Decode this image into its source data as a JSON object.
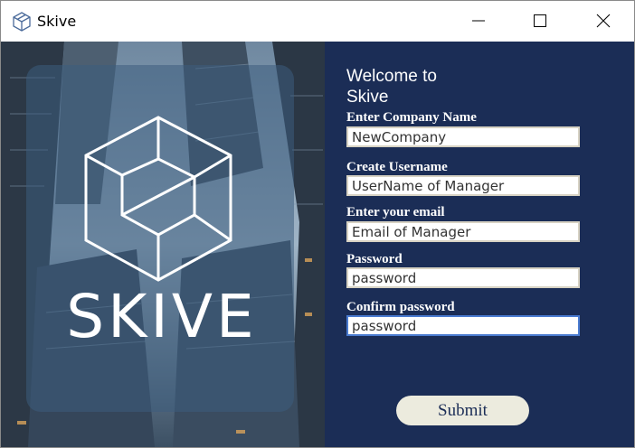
{
  "window": {
    "title": "Skive",
    "controls": {
      "minimize": "minimize-icon",
      "maximize": "maximize-icon",
      "close": "close-icon"
    }
  },
  "branding": {
    "logo_text": "SKIVE",
    "logo_icon": "skive-cube-logo"
  },
  "form": {
    "welcome": "Welcome to Skive",
    "fields": [
      {
        "label": "Enter Company Name",
        "value": "NewCompany"
      },
      {
        "label": "Create Username",
        "value": "UserName of Manager"
      },
      {
        "label": "Enter your email",
        "value": "Email of Manager"
      },
      {
        "label": "Password",
        "value": "password"
      },
      {
        "label": "Confirm password",
        "value": "password"
      }
    ],
    "submit_label": "Submit"
  },
  "colors": {
    "form_background": "#1b2d56",
    "button_background": "#ecebde",
    "text_light": "#ffffff"
  }
}
